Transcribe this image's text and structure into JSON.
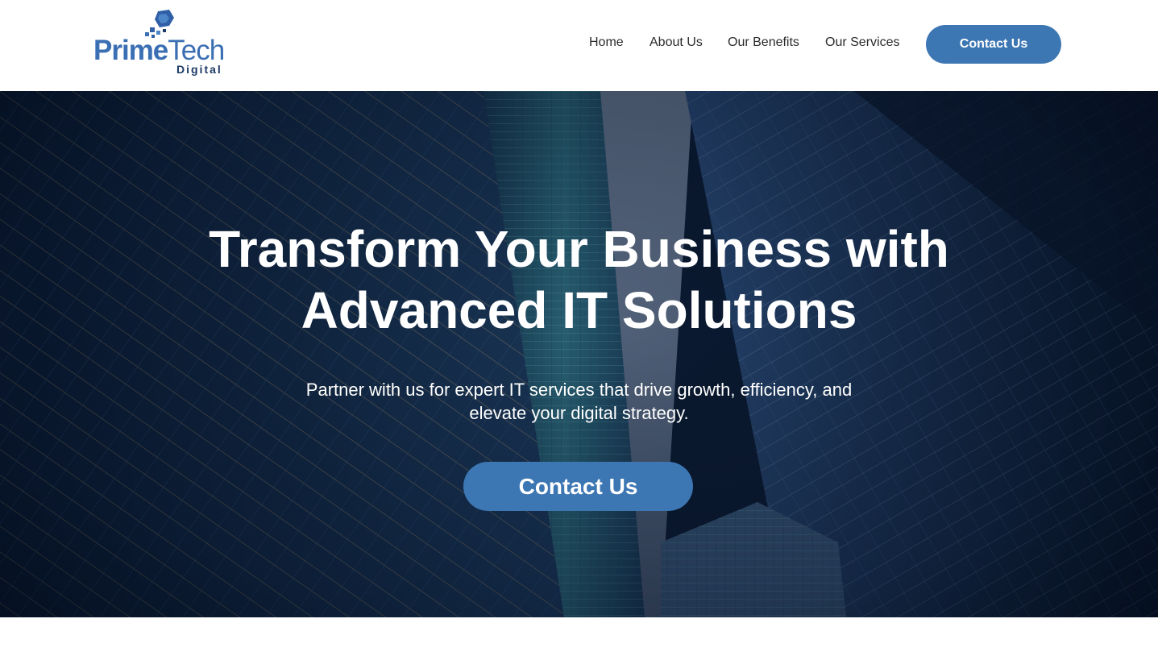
{
  "brand": {
    "name_part1": "Prime",
    "name_part2": "Tech",
    "tagline": "Digital",
    "color_primary": "#3b6fb3",
    "color_dark": "#1e3a66"
  },
  "nav": {
    "items": [
      {
        "label": "Home"
      },
      {
        "label": "About Us"
      },
      {
        "label": "Our Benefits"
      },
      {
        "label": "Our Services"
      }
    ],
    "cta_label": "Contact Us"
  },
  "hero": {
    "title_line1": "Transform Your Business with",
    "title_line2": "Advanced IT Solutions",
    "subtitle_line1": "Partner with us for expert IT services that drive growth, efficiency, and",
    "subtitle_line2": "elevate your digital strategy.",
    "cta_label": "Contact Us",
    "background_image": "skyscrapers-looking-up-icon"
  },
  "colors": {
    "accent": "#3d77b3",
    "hero_dark": "#0d1e36",
    "nav_text": "#2b2b2b"
  }
}
